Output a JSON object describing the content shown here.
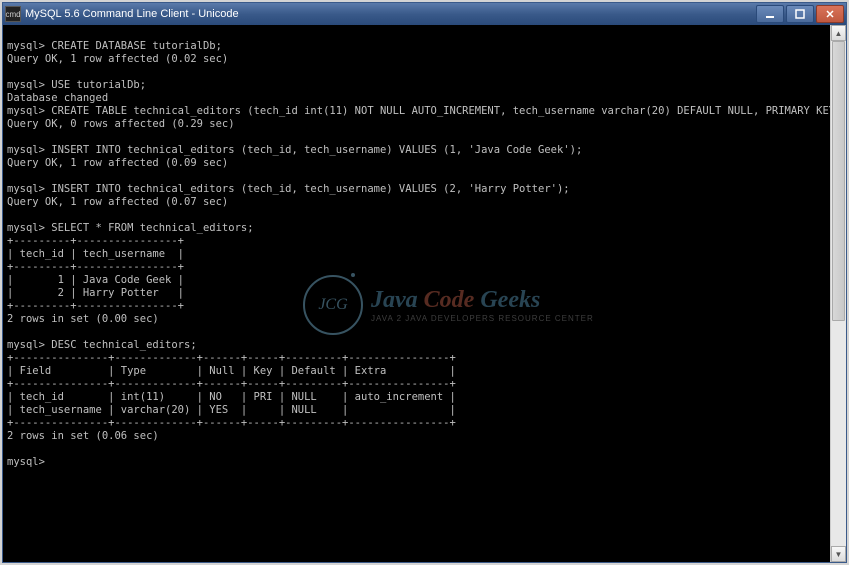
{
  "titlebar": {
    "icon_label": "cmd",
    "title": "MySQL 5.6 Command Line Client - Unicode"
  },
  "terminal": {
    "lines": [
      "",
      "mysql> CREATE DATABASE tutorialDb;",
      "Query OK, 1 row affected (0.02 sec)",
      "",
      "mysql> USE tutorialDb;",
      "Database changed",
      "mysql> CREATE TABLE technical_editors (tech_id int(11) NOT NULL AUTO_INCREMENT, tech_username varchar(20) DEFAULT NULL, PRIMARY KEY (tech_id));",
      "Query OK, 0 rows affected (0.29 sec)",
      "",
      "mysql> INSERT INTO technical_editors (tech_id, tech_username) VALUES (1, 'Java Code Geek');",
      "Query OK, 1 row affected (0.09 sec)",
      "",
      "mysql> INSERT INTO technical_editors (tech_id, tech_username) VALUES (2, 'Harry Potter');",
      "Query OK, 1 row affected (0.07 sec)",
      "",
      "mysql> SELECT * FROM technical_editors;",
      "+---------+----------------+",
      "| tech_id | tech_username  |",
      "+---------+----------------+",
      "|       1 | Java Code Geek |",
      "|       2 | Harry Potter   |",
      "+---------+----------------+",
      "2 rows in set (0.00 sec)",
      "",
      "mysql> DESC technical_editors;",
      "+---------------+-------------+------+-----+---------+----------------+",
      "| Field         | Type        | Null | Key | Default | Extra          |",
      "+---------------+-------------+------+-----+---------+----------------+",
      "| tech_id       | int(11)     | NO   | PRI | NULL    | auto_increment |",
      "| tech_username | varchar(20) | YES  |     | NULL    |                |",
      "+---------------+-------------+------+-----+---------+----------------+",
      "2 rows in set (0.06 sec)",
      "",
      "mysql>"
    ]
  },
  "watermark": {
    "logo_text": "JCG",
    "main_a": "Java ",
    "main_b": "Code",
    "main_c": " Geeks",
    "sub": "Java 2 Java Developers Resource Center"
  }
}
